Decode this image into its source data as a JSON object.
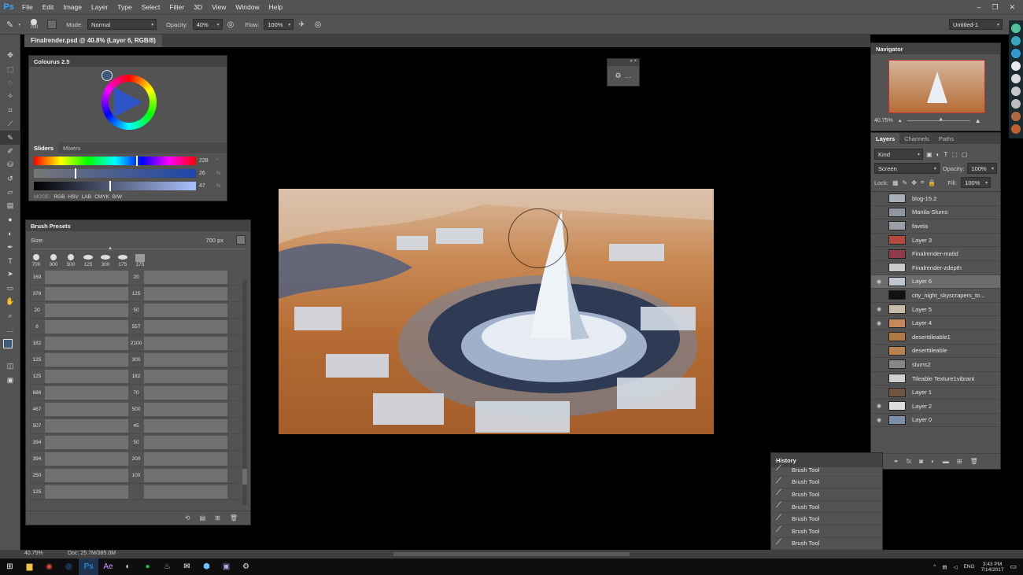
{
  "app": {
    "logo": "Ps"
  },
  "menu": [
    "File",
    "Edit",
    "Image",
    "Layer",
    "Type",
    "Select",
    "Filter",
    "3D",
    "View",
    "Window",
    "Help"
  ],
  "window_controls": [
    "–",
    "❐",
    "✕"
  ],
  "options_bar": {
    "brush_size": "700",
    "mode_label": "Mode:",
    "mode_value": "Normal",
    "opacity_label": "Opacity:",
    "opacity_value": "40%",
    "flow_label": "Flow:",
    "flow_value": "100%",
    "workspace_value": "Untitled-1"
  },
  "document": {
    "tab_title": "Finalrender.psd @ 40.8% (Layer 6, RGB/8)"
  },
  "toolbar": {
    "icons": [
      "move-icon",
      "marquee-icon",
      "lasso-icon",
      "magic-wand-icon",
      "crop-icon",
      "eyedropper-icon",
      "brush-icon",
      "pencil-icon",
      "clone-stamp-icon",
      "history-brush-icon",
      "eraser-icon",
      "gradient-icon",
      "blur-icon",
      "dodge-icon",
      "pen-icon",
      "type-icon",
      "path-select-icon",
      "shape-icon",
      "hand-icon",
      "zoom-icon",
      "more-icon"
    ]
  },
  "colours_panel": {
    "title": "Colourus 2.5",
    "tabs": [
      "Sliders",
      "Mixers"
    ],
    "slider_values": [
      "228",
      "26",
      "47"
    ],
    "slider_units": [
      "°",
      "%",
      "%"
    ],
    "modes_label": "MODE:",
    "modes": [
      "RGB",
      "HSV",
      "LAB",
      "CMYK",
      "B/W"
    ]
  },
  "brush_presets": {
    "title": "Brush Presets",
    "size_label": "Size:",
    "size_value": "700 px",
    "top_sizes": [
      "700",
      "300",
      "500",
      "125",
      "300",
      "175",
      "175"
    ],
    "left_sizes": [
      "169",
      "376",
      "20",
      "6",
      "182",
      "125",
      "125",
      "686",
      "467",
      "507",
      "394",
      "394",
      "250",
      "125"
    ],
    "right_sizes": [
      "20",
      "125",
      "50",
      "557",
      "2100",
      "300",
      "182",
      "70",
      "500",
      "45",
      "50",
      "200",
      "100",
      ""
    ]
  },
  "navigator": {
    "title": "Navigator",
    "zoom": "40.75%"
  },
  "layers_panel": {
    "tabs": [
      "Layers",
      "Channels",
      "Paths"
    ],
    "filter": "Kind",
    "blend_mode": "Screen",
    "opacity_label": "Opacity:",
    "opacity_value": "100%",
    "lock_label": "Lock:",
    "fill_label": "Fill:",
    "fill_value": "100%",
    "layers": [
      {
        "name": "blog-15.2",
        "visible": false,
        "thumb": "#a9afb8"
      },
      {
        "name": "Manila-Slums",
        "visible": false,
        "thumb": "#8f969e"
      },
      {
        "name": "favela",
        "visible": false,
        "thumb": "#9aa0a6"
      },
      {
        "name": "Layer 3",
        "visible": false,
        "thumb": "#b34a3c"
      },
      {
        "name": "Finalrender-matid",
        "visible": false,
        "thumb": "#8e3b4a"
      },
      {
        "name": "Finalrender-zdepth",
        "visible": false,
        "thumb": "#c9c9c9"
      },
      {
        "name": "Layer 6",
        "visible": true,
        "thumb": "#bfc6d1"
      },
      {
        "name": "city_night_skyscrapers_to...",
        "visible": false,
        "thumb": "#111111"
      },
      {
        "name": "Layer 5",
        "visible": true,
        "thumb": "#c8bca8"
      },
      {
        "name": "Layer 4",
        "visible": true,
        "thumb": "#c58a5a"
      },
      {
        "name": "deserttileable1",
        "visible": false,
        "thumb": "#b07845"
      },
      {
        "name": "deserttileable",
        "visible": false,
        "thumb": "#b8824e"
      },
      {
        "name": "slums2",
        "visible": false,
        "thumb": "#868686"
      },
      {
        "name": "Tileable Texture1vibrant",
        "visible": false,
        "thumb": "#d0d0d0"
      },
      {
        "name": "Layer 1",
        "visible": false,
        "thumb": "#6f5440"
      },
      {
        "name": "Layer 2",
        "visible": true,
        "thumb": "#dddddd"
      },
      {
        "name": "Layer 0",
        "visible": true,
        "thumb": "#7b8fa8"
      }
    ]
  },
  "history_panel": {
    "title": "History",
    "items": [
      "Brush Tool",
      "Brush Tool",
      "Brush Tool",
      "Brush Tool",
      "Brush Tool",
      "Brush Tool",
      "Brush Tool",
      "Brush Tool"
    ]
  },
  "status": {
    "zoom": "40.75%",
    "doc": "Doc: 25.7M/385.0M"
  },
  "taskbar": {
    "lang": "ENG",
    "time": "3:43 PM",
    "date": "7/14/2017"
  }
}
